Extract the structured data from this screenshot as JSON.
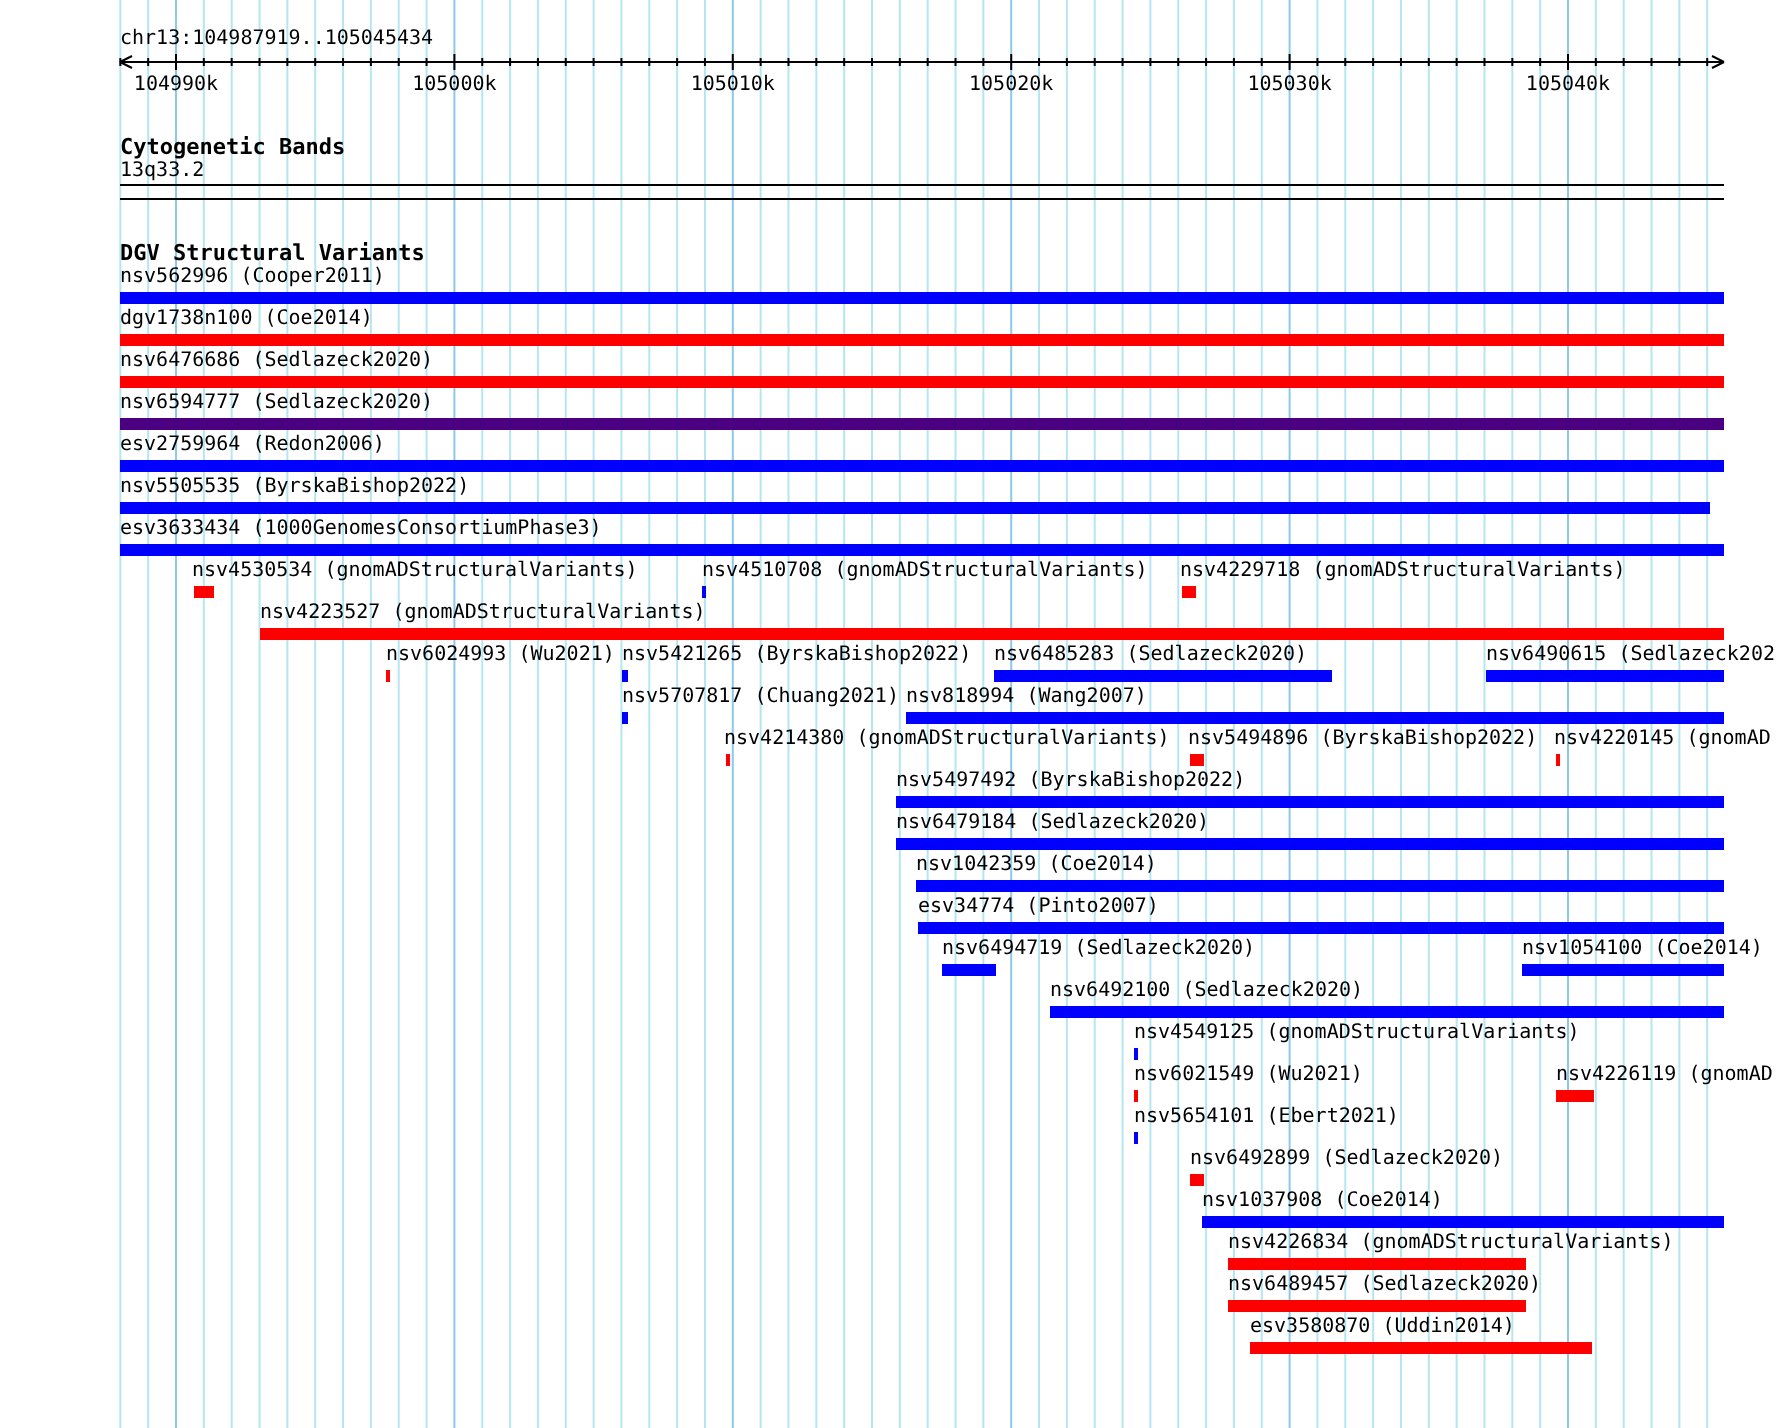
{
  "ruler": {
    "locus": "chr13:104987919..105045434",
    "ticks": [
      "104990k",
      "105000k",
      "105010k",
      "105020k",
      "105030k",
      "105040k"
    ]
  },
  "cytogenetic_bands": {
    "title": "Cytogenetic Bands",
    "band": "13q33.2"
  },
  "structural_variants": {
    "title": "DGV Structural Variants",
    "features": [
      {
        "label": "nsv562996 (Cooper2011)",
        "color": "#0000ff"
      },
      {
        "label": "dgv1738n100 (Coe2014)",
        "color": "#ff0000"
      },
      {
        "label": "nsv6476686 (Sedlazeck2020)",
        "color": "#ff0000"
      },
      {
        "label": "nsv6594777 (Sedlazeck2020)",
        "color": "#4b0082"
      },
      {
        "label": "esv2759964 (Redon2006)",
        "color": "#0000ff"
      },
      {
        "label": "nsv5505535 (ByrskaBishop2022)",
        "color": "#0000ff"
      },
      {
        "label": "esv3633434 (1000GenomesConsortiumPhase3)",
        "color": "#0000ff"
      },
      {
        "label": "nsv4530534 (gnomADStructuralVariants)",
        "color": "#ff0000"
      },
      {
        "label": "nsv4510708 (gnomADStructuralVariants)",
        "color": "#0000ff"
      },
      {
        "label": "nsv4229718 (gnomADStructuralVariants)",
        "color": "#ff0000"
      },
      {
        "label": "nsv4223527 (gnomADStructuralVariants)",
        "color": "#ff0000"
      },
      {
        "label": "nsv6024993 (Wu2021)",
        "color": "#ff0000"
      },
      {
        "label": "nsv5421265 (ByrskaBishop2022)",
        "color": "#0000ff"
      },
      {
        "label": "nsv6485283 (Sedlazeck2020)",
        "color": "#0000ff"
      },
      {
        "label": "nsv6490615 (Sedlazeck202",
        "color": "#0000ff"
      },
      {
        "label": "nsv5707817 (Chuang2021)",
        "color": "#0000ff"
      },
      {
        "label": "nsv818994 (Wang2007)",
        "color": "#0000ff"
      },
      {
        "label": "nsv4214380 (gnomADStructuralVariants)",
        "color": "#ff0000"
      },
      {
        "label": "nsv5494896 (ByrskaBishop2022)",
        "color": "#ff0000"
      },
      {
        "label": "nsv4220145 (gnomAD",
        "color": "#ff0000"
      },
      {
        "label": "nsv5497492 (ByrskaBishop2022)",
        "color": "#0000ff"
      },
      {
        "label": "nsv6479184 (Sedlazeck2020)",
        "color": "#0000ff"
      },
      {
        "label": "nsv1042359 (Coe2014)",
        "color": "#0000ff"
      },
      {
        "label": "esv34774 (Pinto2007)",
        "color": "#0000ff"
      },
      {
        "label": "nsv6494719 (Sedlazeck2020)",
        "color": "#0000ff"
      },
      {
        "label": "nsv1054100 (Coe2014)",
        "color": "#0000ff"
      },
      {
        "label": "nsv6492100 (Sedlazeck2020)",
        "color": "#0000ff"
      },
      {
        "label": "nsv4549125 (gnomADStructuralVariants)",
        "color": "#0000ff"
      },
      {
        "label": "nsv6021549 (Wu2021)",
        "color": "#ff0000"
      },
      {
        "label": "nsv4226119 (gnomAD",
        "color": "#ff0000"
      },
      {
        "label": "nsv5654101 (Ebert2021)",
        "color": "#0000ff"
      },
      {
        "label": "nsv6492899 (Sedlazeck2020)",
        "color": "#ff0000"
      },
      {
        "label": "nsv1037908 (Coe2014)",
        "color": "#0000ff"
      },
      {
        "label": "nsv4226834 (gnomADStructuralVariants)",
        "color": "#ff0000"
      },
      {
        "label": "nsv6489457 (Sedlazeck2020)",
        "color": "#ff0000"
      },
      {
        "label": "esv3580870 (Uddin2014)",
        "color": "#ff0000"
      }
    ]
  }
}
